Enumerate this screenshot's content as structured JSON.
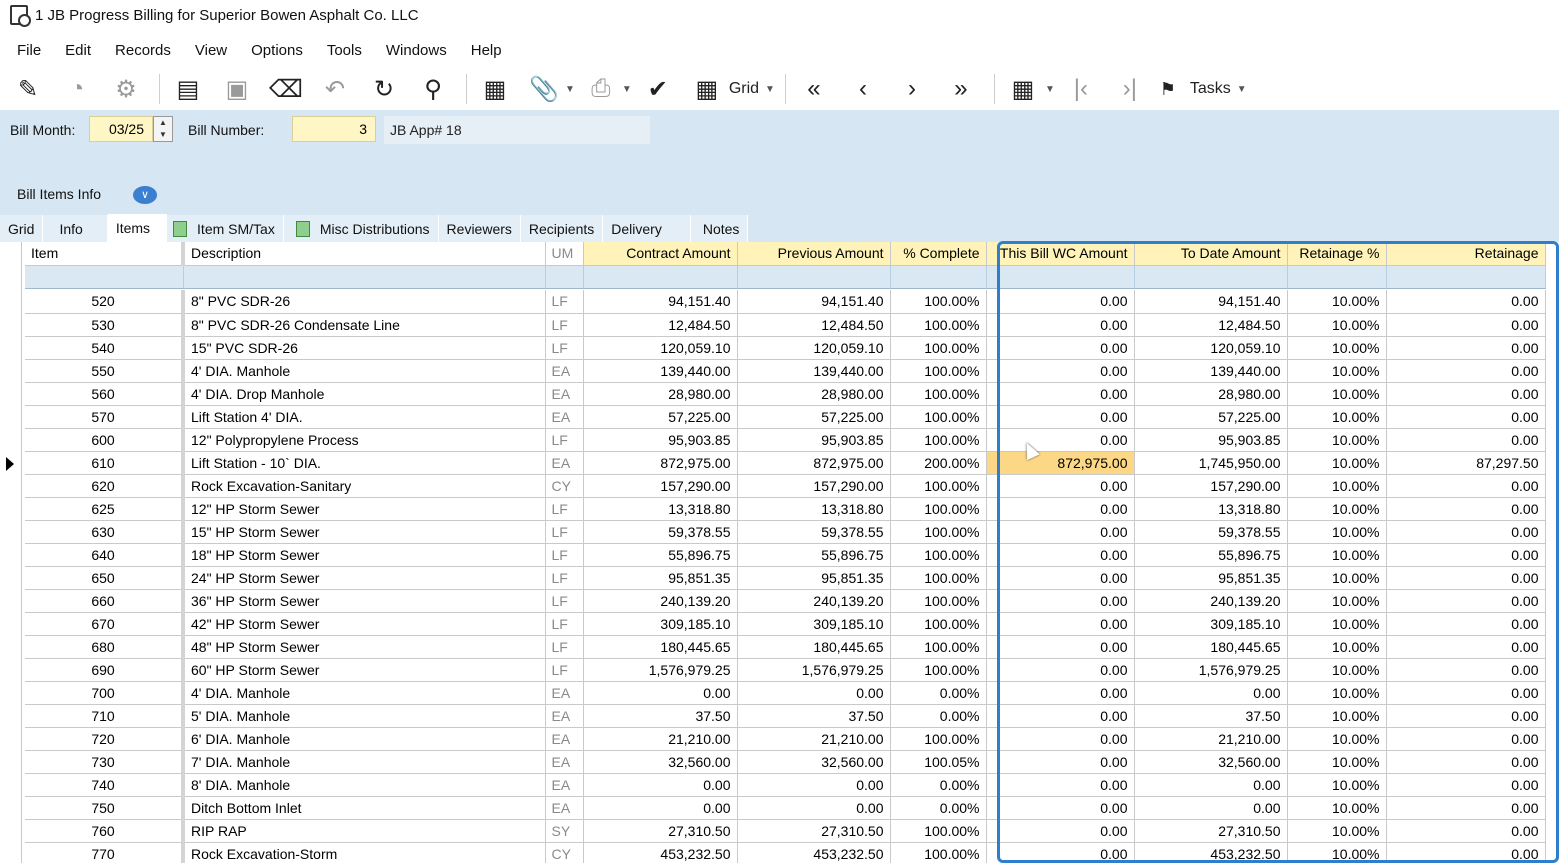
{
  "window": {
    "title": "1 JB Progress Billing for Superior Bowen  Asphalt Co. LLC"
  },
  "menu": [
    "File",
    "Edit",
    "Records",
    "View",
    "Options",
    "Tools",
    "Windows",
    "Help"
  ],
  "toolbar": {
    "grid_label": "Grid",
    "tasks_label": "Tasks"
  },
  "header": {
    "bill_month_label": "Bill Month:",
    "bill_month_value": "03/25",
    "bill_number_label": "Bill Number:",
    "bill_number_value": "3",
    "jb_app_text": "JB App# 18"
  },
  "section": {
    "title": "Bill Items Info"
  },
  "tabs": [
    "Grid",
    "Info",
    "Items",
    "Item SM/Tax",
    "Misc Distributions",
    "Reviewers",
    "Recipients",
    "Delivery",
    "Notes"
  ],
  "active_tab": "Items",
  "grid": {
    "columns": [
      "Item",
      "Description",
      "UM",
      "Contract Amount",
      "Previous Amount",
      "% Complete",
      "This Bill WC Amount",
      "To Date Amount",
      "Retainage %",
      "Retainage"
    ],
    "rows": [
      [
        "520",
        "8\" PVC SDR-26",
        "LF",
        "94,151.40",
        "94,151.40",
        "100.00%",
        "0.00",
        "94,151.40",
        "10.00%",
        "0.00"
      ],
      [
        "530",
        "8\" PVC SDR-26 Condensate Line",
        "LF",
        "12,484.50",
        "12,484.50",
        "100.00%",
        "0.00",
        "12,484.50",
        "10.00%",
        "0.00"
      ],
      [
        "540",
        "15\" PVC SDR-26",
        "LF",
        "120,059.10",
        "120,059.10",
        "100.00%",
        "0.00",
        "120,059.10",
        "10.00%",
        "0.00"
      ],
      [
        "550",
        "4' DIA. Manhole",
        "EA",
        "139,440.00",
        "139,440.00",
        "100.00%",
        "0.00",
        "139,440.00",
        "10.00%",
        "0.00"
      ],
      [
        "560",
        "4' DIA. Drop Manhole",
        "EA",
        "28,980.00",
        "28,980.00",
        "100.00%",
        "0.00",
        "28,980.00",
        "10.00%",
        "0.00"
      ],
      [
        "570",
        "Lift Station 4' DIA.",
        "EA",
        "57,225.00",
        "57,225.00",
        "100.00%",
        "0.00",
        "57,225.00",
        "10.00%",
        "0.00"
      ],
      [
        "600",
        "12\" Polypropylene Process",
        "LF",
        "95,903.85",
        "95,903.85",
        "100.00%",
        "0.00",
        "95,903.85",
        "10.00%",
        "0.00"
      ],
      [
        "610",
        "Lift Station - 10` DIA.",
        "EA",
        "872,975.00",
        "872,975.00",
        "200.00%",
        "872,975.00",
        "1,745,950.00",
        "10.00%",
        "87,297.50"
      ],
      [
        "620",
        "Rock Excavation-Sanitary",
        "CY",
        "157,290.00",
        "157,290.00",
        "100.00%",
        "0.00",
        "157,290.00",
        "10.00%",
        "0.00"
      ],
      [
        "625",
        "12\" HP Storm Sewer",
        "LF",
        "13,318.80",
        "13,318.80",
        "100.00%",
        "0.00",
        "13,318.80",
        "10.00%",
        "0.00"
      ],
      [
        "630",
        "15\" HP Storm Sewer",
        "LF",
        "59,378.55",
        "59,378.55",
        "100.00%",
        "0.00",
        "59,378.55",
        "10.00%",
        "0.00"
      ],
      [
        "640",
        "18\" HP Storm Sewer",
        "LF",
        "55,896.75",
        "55,896.75",
        "100.00%",
        "0.00",
        "55,896.75",
        "10.00%",
        "0.00"
      ],
      [
        "650",
        "24\" HP Storm Sewer",
        "LF",
        "95,851.35",
        "95,851.35",
        "100.00%",
        "0.00",
        "95,851.35",
        "10.00%",
        "0.00"
      ],
      [
        "660",
        "36\" HP Storm Sewer",
        "LF",
        "240,139.20",
        "240,139.20",
        "100.00%",
        "0.00",
        "240,139.20",
        "10.00%",
        "0.00"
      ],
      [
        "670",
        "42\" HP Storm Sewer",
        "LF",
        "309,185.10",
        "309,185.10",
        "100.00%",
        "0.00",
        "309,185.10",
        "10.00%",
        "0.00"
      ],
      [
        "680",
        "48\" HP Storm Sewer",
        "LF",
        "180,445.65",
        "180,445.65",
        "100.00%",
        "0.00",
        "180,445.65",
        "10.00%",
        "0.00"
      ],
      [
        "690",
        "60\" HP Storm Sewer",
        "LF",
        "1,576,979.25",
        "1,576,979.25",
        "100.00%",
        "0.00",
        "1,576,979.25",
        "10.00%",
        "0.00"
      ],
      [
        "700",
        "4' DIA. Manhole",
        "EA",
        "0.00",
        "0.00",
        "0.00%",
        "0.00",
        "0.00",
        "10.00%",
        "0.00"
      ],
      [
        "710",
        "5' DIA. Manhole",
        "EA",
        "37.50",
        "37.50",
        "0.00%",
        "0.00",
        "37.50",
        "10.00%",
        "0.00"
      ],
      [
        "720",
        "6' DIA. Manhole",
        "EA",
        "21,210.00",
        "21,210.00",
        "100.00%",
        "0.00",
        "21,210.00",
        "10.00%",
        "0.00"
      ],
      [
        "730",
        "7' DIA. Manhole",
        "EA",
        "32,560.00",
        "32,560.00",
        "100.05%",
        "0.00",
        "32,560.00",
        "10.00%",
        "0.00"
      ],
      [
        "740",
        "8' DIA. Manhole",
        "EA",
        "0.00",
        "0.00",
        "0.00%",
        "0.00",
        "0.00",
        "10.00%",
        "0.00"
      ],
      [
        "750",
        "Ditch Bottom Inlet",
        "EA",
        "0.00",
        "0.00",
        "0.00%",
        "0.00",
        "0.00",
        "10.00%",
        "0.00"
      ],
      [
        "760",
        "RIP RAP",
        "SY",
        "27,310.50",
        "27,310.50",
        "100.00%",
        "0.00",
        "27,310.50",
        "10.00%",
        "0.00"
      ],
      [
        "770",
        "Rock Excavation-Storm",
        "CY",
        "453,232.50",
        "453,232.50",
        "100.00%",
        "0.00",
        "453,232.50",
        "10.00%",
        "0.00"
      ]
    ]
  },
  "colors": {
    "header_bg": "#d6e6f2",
    "highlight_cell": "#fcd886",
    "focus_border": "#2f7ecb",
    "required_field": "#fff6c6"
  }
}
